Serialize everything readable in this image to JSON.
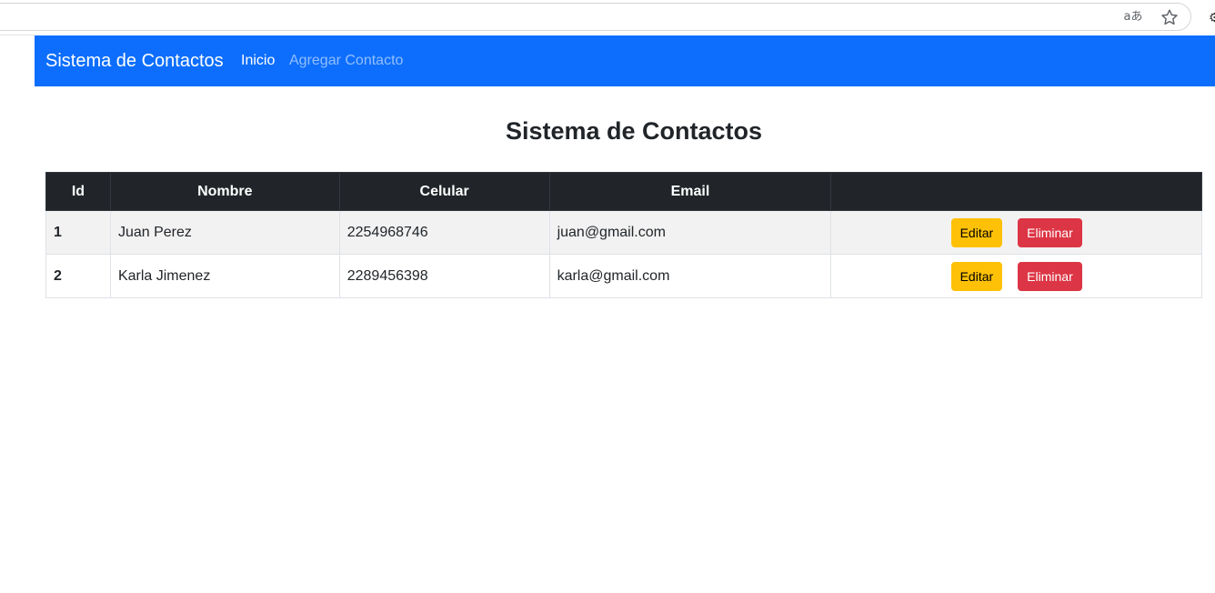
{
  "browser": {
    "translate_glyph": "aあ",
    "icons": [
      "translate-icon",
      "star-icon",
      "extension-icon"
    ]
  },
  "navbar": {
    "brand": "Sistema de Contactos",
    "links": [
      "Inicio",
      "Agregar Contacto"
    ],
    "active_link": "Inicio",
    "color": "#0d6efd"
  },
  "main": {
    "title": "Sistema de Contactos"
  },
  "table": {
    "headers": [
      "Id",
      "Nombre",
      "Celular",
      "Email",
      ""
    ],
    "rows": [
      {
        "id": "1",
        "nombre": "Juan Perez",
        "celular": "2254968746",
        "email": "juan@gmail.com"
      },
      {
        "id": "2",
        "nombre": "Karla Jimenez",
        "celular": "2289456398",
        "email": "karla@gmail.com"
      }
    ],
    "actions": {
      "edit_label": "Editar",
      "delete_label": "Eliminar",
      "edit_color": "#ffc107",
      "delete_color": "#dc3545"
    },
    "header_color": "#212529"
  }
}
